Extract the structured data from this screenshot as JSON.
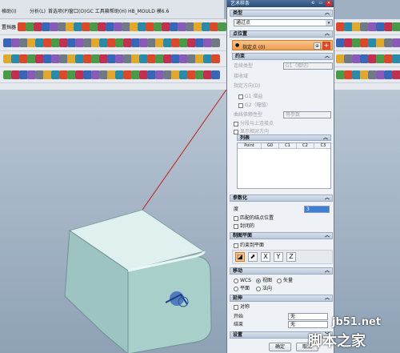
{
  "menu": [
    "格助(I)",
    "分析(L)",
    "首选项(P)",
    "窗口(O)",
    "GC 工具箱",
    "帮助(H)",
    "HB_MOULD 模6.6"
  ],
  "left_menu_label": "置挡器",
  "dialog": {
    "title": "艺术样条",
    "sections": {
      "type": {
        "label": "类型",
        "value": "通过点"
      },
      "points": {
        "label": "点位置",
        "point_btn": "指定点 (0)"
      },
      "constraints": {
        "label": "约束",
        "continuity_type": "连续类型",
        "continuity_value": "G1（相切）",
        "constraint_type": "接收域",
        "specify_direction": "指定方向(D)",
        "g1_gain": "G1 增益",
        "g2_gain": "G2（幅值）",
        "dependency": "曲线依赖性型",
        "dependency_value": "等参数",
        "assoc": "分段与上连接点",
        "show_reference": "显示相对方向",
        "list_label": "列表",
        "columns": [
          "Point",
          "G0",
          "C1",
          "C2",
          "C3"
        ]
      },
      "parameterization": {
        "label": "参数化",
        "degree_label": "度",
        "degree_value": "3",
        "match_knots": "匹配的结点位置",
        "closed": "封闭的"
      },
      "plane": {
        "label": "制图平面",
        "constrain_plane": "约束到平面"
      },
      "movement": {
        "label": "移动",
        "options": [
          {
            "label": "WCS",
            "on": false
          },
          {
            "label": "视图",
            "on": true
          },
          {
            "label": "矢量",
            "on": false
          },
          {
            "label": "平面",
            "on": false
          },
          {
            "label": "法向",
            "on": false
          }
        ]
      },
      "extend": {
        "label": "延伸",
        "symmetric": "对称",
        "start_label": "开始",
        "start_value": "无",
        "end_label": "结束",
        "end_value": "无"
      },
      "settings": {
        "label": "设置"
      }
    },
    "ok_button": "确定",
    "cancel_button": "取消"
  },
  "watermark": {
    "line1": "jb51.net",
    "line2": "脚本之家"
  }
}
